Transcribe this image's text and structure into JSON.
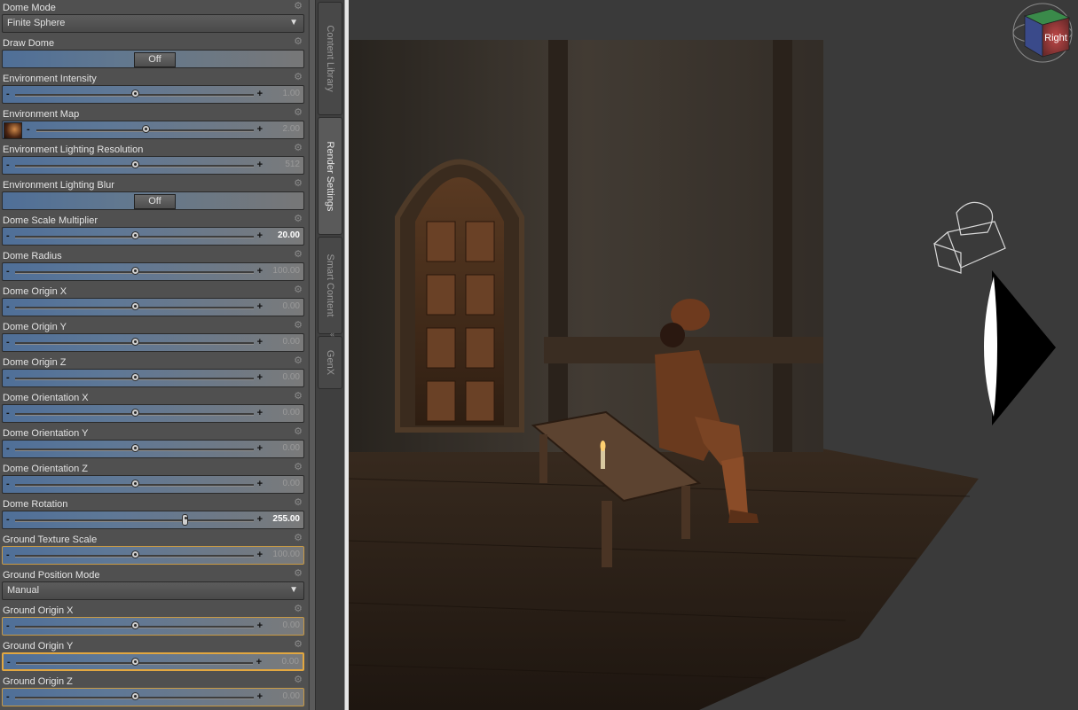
{
  "panel": {
    "properties": [
      {
        "label": "Dome Mode",
        "type": "dropdown",
        "value": "Finite Sphere"
      },
      {
        "label": "Draw Dome",
        "type": "toggle",
        "value": "Off"
      },
      {
        "label": "Environment Intensity",
        "type": "slider",
        "value": "1.00",
        "position": 0.5,
        "bold": false
      },
      {
        "label": "Environment Map",
        "type": "slider",
        "value": "2.00",
        "position": 0.5,
        "bold": false,
        "thumbnail": true
      },
      {
        "label": "Environment Lighting Resolution",
        "type": "slider",
        "value": "512",
        "position": 0.5,
        "bold": false
      },
      {
        "label": "Environment Lighting Blur",
        "type": "toggle",
        "value": "Off"
      },
      {
        "label": "Dome Scale Multiplier",
        "type": "slider",
        "value": "20.00",
        "position": 0.5,
        "bold": true
      },
      {
        "label": "Dome Radius",
        "type": "slider",
        "value": "100.00",
        "position": 0.5,
        "bold": false
      },
      {
        "label": "Dome Origin X",
        "type": "slider",
        "value": "0.00",
        "position": 0.5,
        "bold": false
      },
      {
        "label": "Dome Origin Y",
        "type": "slider",
        "value": "0.00",
        "position": 0.5,
        "bold": false
      },
      {
        "label": "Dome Origin Z",
        "type": "slider",
        "value": "0.00",
        "position": 0.5,
        "bold": false
      },
      {
        "label": "Dome Orientation X",
        "type": "slider",
        "value": "0.00",
        "position": 0.5,
        "bold": false
      },
      {
        "label": "Dome Orientation Y",
        "type": "slider",
        "value": "0.00",
        "position": 0.5,
        "bold": false
      },
      {
        "label": "Dome Orientation Z",
        "type": "slider",
        "value": "0.00",
        "position": 0.5,
        "bold": false
      },
      {
        "label": "Dome Rotation",
        "type": "slider",
        "value": "255.00",
        "position": 0.71,
        "bold": true,
        "bar_knob": true
      },
      {
        "label": "Ground Texture Scale",
        "type": "slider",
        "value": "100.00",
        "position": 0.5,
        "bold": false,
        "highlight": "light"
      },
      {
        "label": "Ground Position Mode",
        "type": "dropdown",
        "value": "Manual"
      },
      {
        "label": "Ground Origin X",
        "type": "slider",
        "value": "0.00",
        "position": 0.5,
        "bold": false,
        "highlight": "light"
      },
      {
        "label": "Ground Origin Y",
        "type": "slider",
        "value": "0.00",
        "position": 0.5,
        "bold": false,
        "highlight": "strong"
      },
      {
        "label": "Ground Origin Z",
        "type": "slider",
        "value": "0.00",
        "position": 0.5,
        "bold": false,
        "highlight": "light"
      }
    ]
  },
  "tabs": [
    {
      "label": "Content Library",
      "active": false
    },
    {
      "label": "Render Settings",
      "active": true
    },
    {
      "label": "Smart Content",
      "active": false
    },
    {
      "label": "GenX",
      "active": false
    }
  ],
  "viewport": {
    "view_cube_label": "Right"
  },
  "colors": {
    "panel_bg": "#505050",
    "slider_blue": "#4f6f98",
    "highlight_orange": "#e2a740",
    "viewport_bg": "#3a3a3a"
  }
}
